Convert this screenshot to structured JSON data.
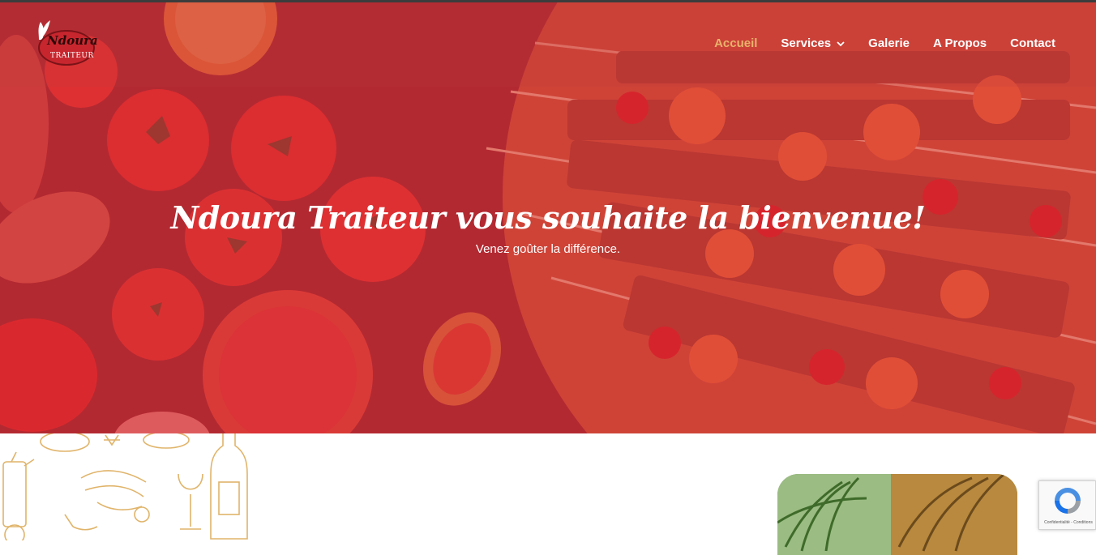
{
  "brand": {
    "logo_name": "Ndoura",
    "logo_sub": "TRAITEUR"
  },
  "nav": {
    "items": [
      {
        "label": "Accueil",
        "active": true
      },
      {
        "label": "Services",
        "active": false,
        "has_dropdown": true
      },
      {
        "label": "Galerie",
        "active": false
      },
      {
        "label": "A Propos",
        "active": false
      },
      {
        "label": "Contact",
        "active": false
      }
    ]
  },
  "hero": {
    "title": "Ndoura Traiteur vous souhaite la bienvenue!",
    "subtitle": "Venez goûter la différence."
  },
  "recaptcha": {
    "text": "Confidentialité - Conditions"
  },
  "colors": {
    "accent": "#e9b36a",
    "hero_overlay": "#d62834",
    "nav_text": "#ffffff"
  },
  "icons": {
    "chevron": "chevron-down-icon",
    "recaptcha": "recaptcha-icon"
  }
}
